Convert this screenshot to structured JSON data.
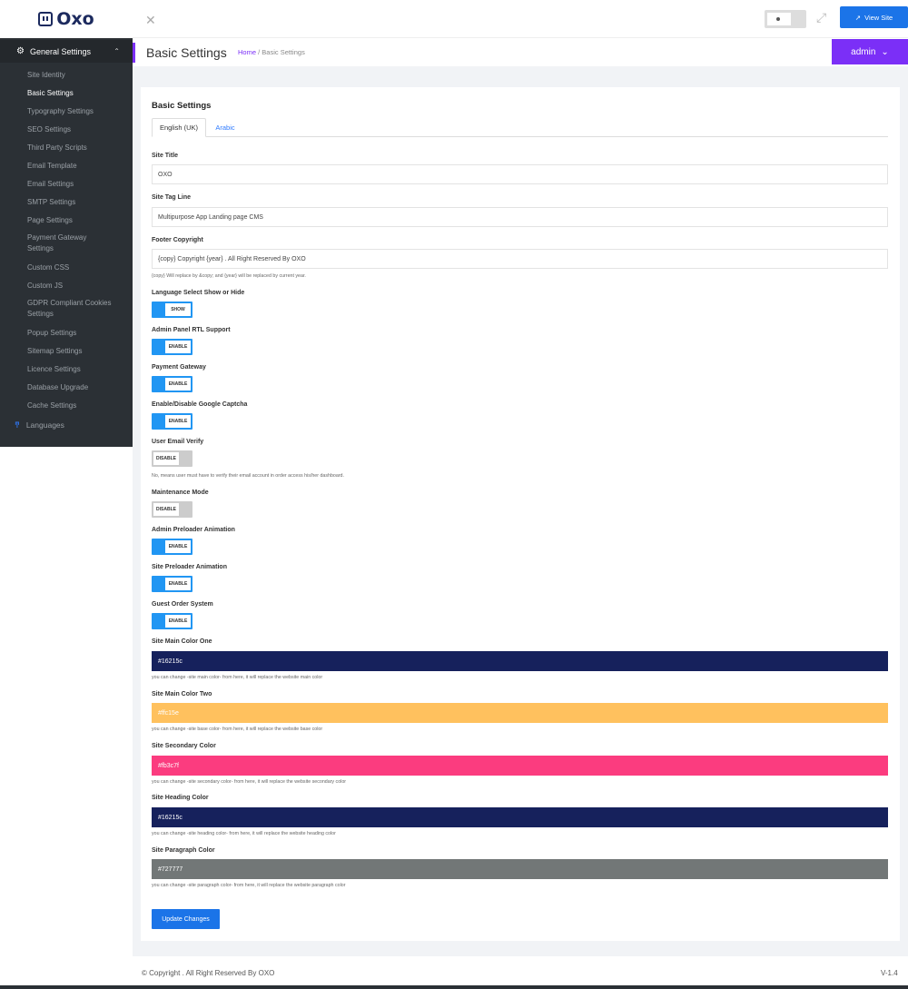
{
  "brand": {
    "name": "Oxo"
  },
  "sidebar": {
    "group_label": "General Settings",
    "items": [
      "Site Identity",
      "Basic Settings",
      "Typography Settings",
      "SEO Settings",
      "Third Party Scripts",
      "Email Template",
      "Email Settings",
      "SMTP Settings",
      "Page Settings",
      "Payment Gateway Settings",
      "Custom CSS",
      "Custom JS",
      "GDPR Compliant Cookies Settings",
      "Popup Settings",
      "Sitemap Settings",
      "Licence Settings",
      "Database Upgrade",
      "Cache Settings"
    ],
    "active_item": "Basic Settings",
    "languages_label": "Languages"
  },
  "topbar": {
    "view_site_label": "View Site"
  },
  "header": {
    "title": "Basic Settings",
    "breadcrumb_home": "Home",
    "breadcrumb_sep": "/",
    "breadcrumb_current": "Basic Settings",
    "user_label": "admin"
  },
  "form": {
    "card_title": "Basic Settings",
    "tabs": [
      "English (UK)",
      "Arabic"
    ],
    "site_title": {
      "label": "Site Title",
      "value": "OXO"
    },
    "site_tag_line": {
      "label": "Site Tag Line",
      "value": "Multipurpose App Landing page CMS"
    },
    "footer_copyright": {
      "label": "Footer Copyright",
      "value": "{copy} Copyright {year} . All Right Reserved By OXO",
      "hint": "{copy} Will replace by &copy; and {year} will be replaced by current year."
    },
    "toggles": [
      {
        "label": "Language Select Show or Hide",
        "state_label": "SHOW",
        "on": true
      },
      {
        "label": "Admin Panel RTL Support",
        "state_label": "ENABLE",
        "on": true
      },
      {
        "label": "Payment Gateway",
        "state_label": "ENABLE",
        "on": true
      },
      {
        "label": "Enable/Disable Google Captcha",
        "state_label": "ENABLE",
        "on": true
      },
      {
        "label": "User Email Verify",
        "state_label": "DISABLE",
        "on": false,
        "hint": "No, means user must have to verify their email account in order access his/her dashboard."
      },
      {
        "label": "Maintenance Mode",
        "state_label": "DISABLE",
        "on": false
      },
      {
        "label": "Admin Preloader Animation",
        "state_label": "ENABLE",
        "on": true
      },
      {
        "label": "Site Preloader Animation",
        "state_label": "ENABLE",
        "on": true
      },
      {
        "label": "Guest Order System",
        "state_label": "ENABLE",
        "on": true
      }
    ],
    "colors": [
      {
        "label": "Site Main Color One",
        "value": "#16215c",
        "hint": "you can change -site main color- from here, it will replace the website main color"
      },
      {
        "label": "Site Main Color Two",
        "value": "#ffc15e",
        "hint": "you can change -site base color- from here, it will replace the website base color"
      },
      {
        "label": "Site Secondary Color",
        "value": "#fb3c7f",
        "hint": "you can change -site secondary color- from here, it will replace the website secondary color"
      },
      {
        "label": "Site Heading Color",
        "value": "#16215c",
        "hint": "you can change -site heading color- from here, it will replace the website heading color"
      },
      {
        "label": "Site Paragraph Color",
        "value": "#727777",
        "hint": "you can change -site paragraph color- from here, it will replace the website paragraph color"
      }
    ],
    "submit_label": "Update Changes"
  },
  "footer": {
    "copyright": "© Copyright . All Right Reserved By OXO",
    "version": "V-1.4"
  }
}
